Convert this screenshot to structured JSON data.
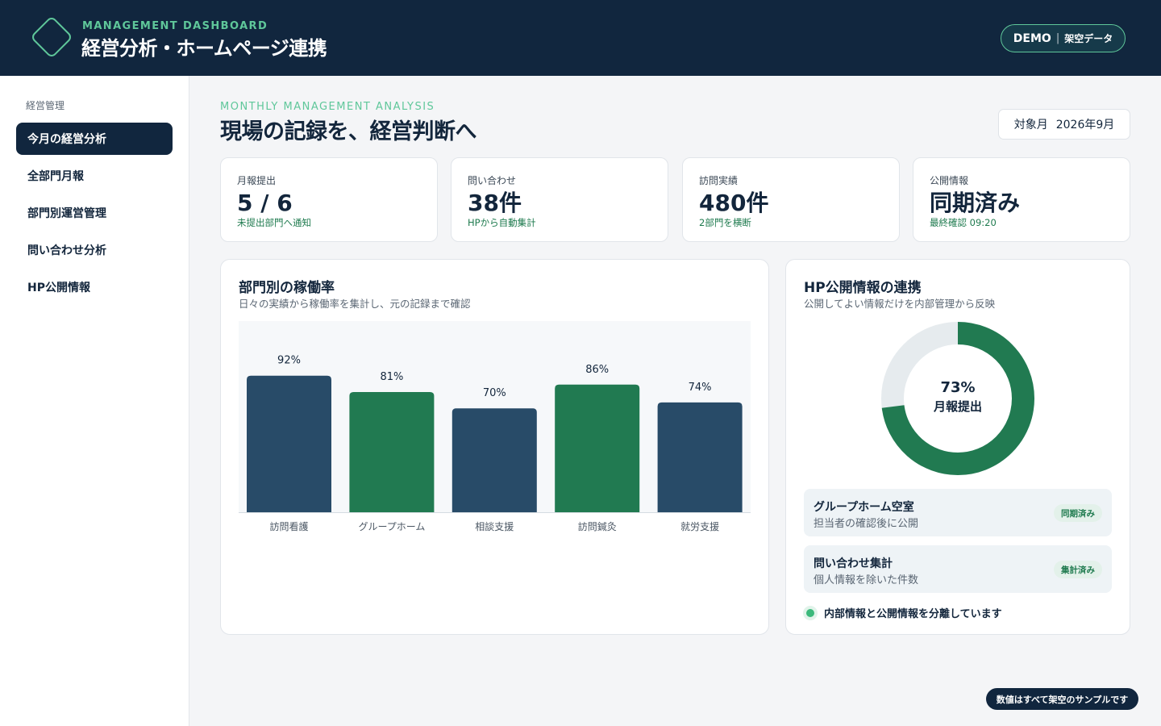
{
  "header": {
    "brand_sub": "MANAGEMENT DASHBOARD",
    "brand_title": "経営分析・ホームページ連携",
    "logo_icon": "diamond-logo-icon",
    "demo_strong": "DEMO",
    "demo_separator": "|",
    "demo_text": "架空データ"
  },
  "sidebar": {
    "heading": "経営管理",
    "items": [
      {
        "label": "今月の経営分析",
        "active": true
      },
      {
        "label": "全部門月報",
        "active": false
      },
      {
        "label": "部門別運営管理",
        "active": false
      },
      {
        "label": "問い合わせ分析",
        "active": false
      },
      {
        "label": "HP公開情報",
        "active": false
      }
    ]
  },
  "main": {
    "eyebrow": "MONTHLY MANAGEMENT ANALYSIS",
    "title": "現場の記録を、経営判断へ",
    "month_label": "対象月",
    "month_value": "2026年9月"
  },
  "kpis": [
    {
      "label": "月報提出",
      "value": "5 / 6",
      "note": "未提出部門へ通知"
    },
    {
      "label": "問い合わせ",
      "value": "38件",
      "note": "HPから自動集計"
    },
    {
      "label": "訪問実績",
      "value": "480件",
      "note": "2部門を横断"
    },
    {
      "label": "公開情報",
      "value": "同期済み",
      "note": "最終確認 09:20"
    }
  ],
  "utilization": {
    "title": "部門別の稼働率",
    "subtitle": "日々の実績から稼働率を集計し、元の記録まで確認"
  },
  "chart_data": {
    "type": "bar",
    "categories": [
      "訪問看護",
      "グループホーム",
      "相談支援",
      "訪問鍼灸",
      "就労支援"
    ],
    "values": [
      92,
      81,
      70,
      86,
      74
    ],
    "value_labels": [
      "92%",
      "81%",
      "70%",
      "86%",
      "74%"
    ],
    "bar_colors": [
      "#284b68",
      "#217a51",
      "#284b68",
      "#217a51",
      "#284b68"
    ],
    "ylim": [
      0,
      100
    ],
    "grid": false,
    "title": "",
    "xlabel": "",
    "ylabel": ""
  },
  "hp_sync": {
    "title": "HP公開情報の連携",
    "subtitle": "公開してよい情報だけを内部管理から反映",
    "donut_percent": 73,
    "donut_percent_label": "73%",
    "donut_label": "月報提出",
    "donut_color": "#217a51",
    "donut_track_color": "#e6ebee",
    "cards": [
      {
        "title": "グループホーム空室",
        "subtitle": "担当者の確認後に公開",
        "badge": "同期済み"
      },
      {
        "title": "問い合わせ集計",
        "subtitle": "個人情報を除いた件数",
        "badge": "集計済み"
      }
    ],
    "note": "内部情報と公開情報を分離しています"
  },
  "footer": {
    "note": "数値はすべて架空のサンプルです"
  }
}
